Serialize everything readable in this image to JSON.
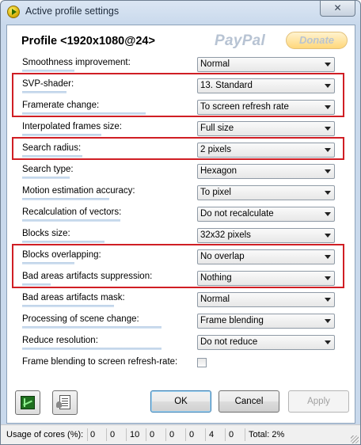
{
  "window": {
    "title": "Active profile settings",
    "close_glyph": "✕"
  },
  "header": {
    "profile_title": "Profile <1920x1080@24>",
    "paypal_text": "PayPal",
    "donate_label": "Donate"
  },
  "settings": [
    {
      "label": "Smoothness improvement:",
      "control": "combo",
      "value": "Normal",
      "highlighted": false
    },
    {
      "label": "SVP-shader:",
      "control": "combo",
      "value": "13. Standard",
      "highlighted": true
    },
    {
      "label": "Framerate change:",
      "control": "combo",
      "value": "To screen refresh rate",
      "highlighted": true
    },
    {
      "label": "Interpolated frames size:",
      "control": "combo",
      "value": "Full size",
      "highlighted": false
    },
    {
      "label": "Search radius:",
      "control": "combo",
      "value": "2 pixels",
      "highlighted": true
    },
    {
      "label": "Search type:",
      "control": "combo",
      "value": "Hexagon",
      "highlighted": false
    },
    {
      "label": "Motion estimation accuracy:",
      "control": "combo",
      "value": "To pixel",
      "highlighted": false
    },
    {
      "label": "Recalculation of vectors:",
      "control": "combo",
      "value": "Do not recalculate",
      "highlighted": false
    },
    {
      "label": "Blocks size:",
      "control": "combo",
      "value": "32x32 pixels",
      "highlighted": false
    },
    {
      "label": "Blocks overlapping:",
      "control": "combo",
      "value": "No overlap",
      "highlighted": true
    },
    {
      "label": "Bad areas artifacts suppression:",
      "control": "combo",
      "value": "Nothing",
      "highlighted": true
    },
    {
      "label": "Bad areas artifacts mask:",
      "control": "combo",
      "value": "Normal",
      "highlighted": false
    },
    {
      "label": "Processing of scene change:",
      "control": "combo",
      "value": "Frame blending",
      "highlighted": false
    },
    {
      "label": "Reduce resolution:",
      "control": "combo",
      "value": "Do not reduce",
      "highlighted": false
    },
    {
      "label": "Frame blending to screen refresh-rate:",
      "control": "checkbox",
      "checked": false,
      "highlighted": false
    }
  ],
  "label_level": [
    0.33,
    0.28,
    0.78,
    0.5,
    0.38,
    0.3,
    0.55,
    0.62,
    0.52,
    0.33,
    0.18,
    0.58,
    0.88,
    0.88
  ],
  "toolbar": {
    "icons": [
      "graph-icon",
      "clipboard-list-icon"
    ]
  },
  "buttons": {
    "ok": "OK",
    "cancel": "Cancel",
    "apply": "Apply",
    "apply_enabled": false
  },
  "status": {
    "label": "Usage of cores (%):",
    "cores": [
      "0",
      "0",
      "10",
      "0",
      "0",
      "0",
      "4",
      "0"
    ],
    "total": "Total: 2%"
  },
  "colors": {
    "highlight": "#d01e24",
    "accent_bar": "#b9cfe6"
  }
}
